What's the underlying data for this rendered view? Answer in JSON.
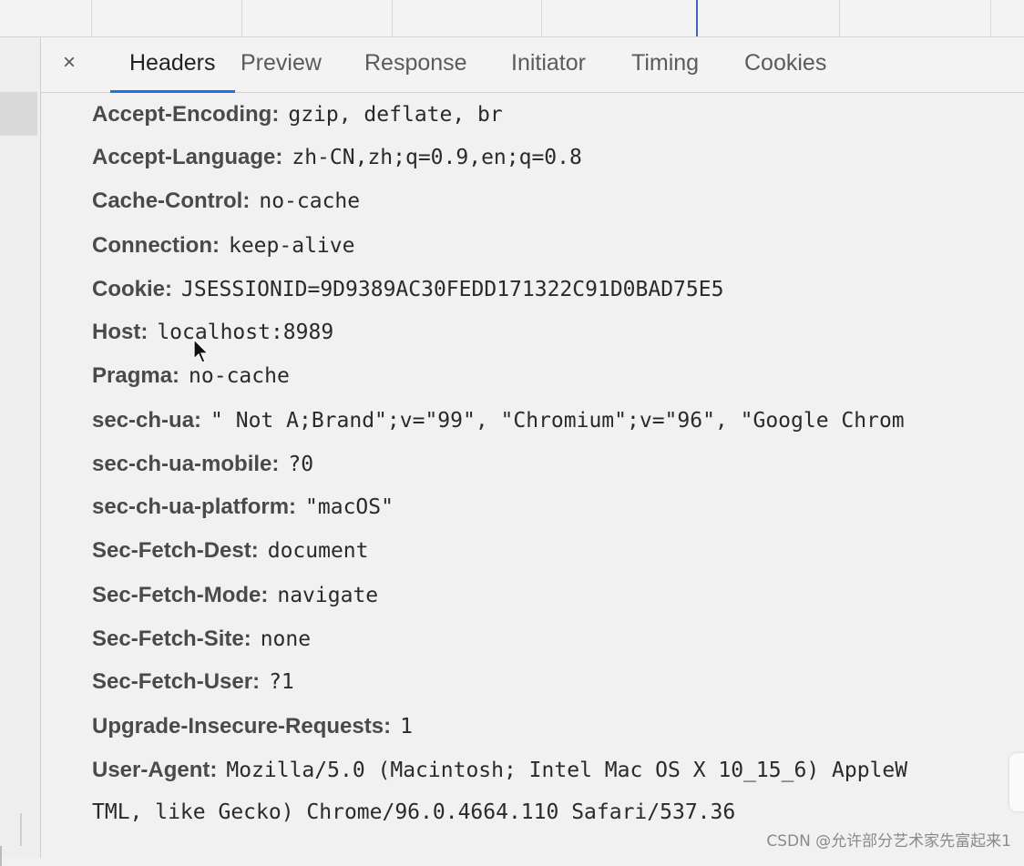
{
  "tabs": {
    "close_symbol": "×",
    "items": [
      "Headers",
      "Preview",
      "Response",
      "Initiator",
      "Timing",
      "Cookies"
    ]
  },
  "headers": [
    {
      "name": "Accept-Encoding:",
      "value": "gzip, deflate, br"
    },
    {
      "name": "Accept-Language:",
      "value": "zh-CN,zh;q=0.9,en;q=0.8"
    },
    {
      "name": "Cache-Control:",
      "value": "no-cache"
    },
    {
      "name": "Connection:",
      "value": "keep-alive"
    },
    {
      "name": "Cookie:",
      "value": "JSESSIONID=9D9389AC30FEDD171322C91D0BAD75E5"
    },
    {
      "name": "Host:",
      "value": "localhost:8989"
    },
    {
      "name": "Pragma:",
      "value": "no-cache"
    },
    {
      "name": "sec-ch-ua:",
      "value": "\" Not A;Brand\";v=\"99\", \"Chromium\";v=\"96\", \"Google Chrom"
    },
    {
      "name": "sec-ch-ua-mobile:",
      "value": "?0"
    },
    {
      "name": "sec-ch-ua-platform:",
      "value": "\"macOS\""
    },
    {
      "name": "Sec-Fetch-Dest:",
      "value": "document"
    },
    {
      "name": "Sec-Fetch-Mode:",
      "value": "navigate"
    },
    {
      "name": "Sec-Fetch-Site:",
      "value": "none"
    },
    {
      "name": "Sec-Fetch-User:",
      "value": "?1"
    },
    {
      "name": "Upgrade-Insecure-Requests:",
      "value": "1"
    },
    {
      "name": "User-Agent:",
      "value": "Mozilla/5.0 (Macintosh; Intel Mac OS X 10_15_6) AppleW"
    }
  ],
  "user_agent_continuation": "TML, like Gecko) Chrome/96.0.4664.110 Safari/537.36",
  "watermark": "CSDN @允许部分艺术家先富起来1",
  "colors": {
    "active_tab_underline": "#1a73e8",
    "waterfall_marker": "#3a66c8"
  }
}
